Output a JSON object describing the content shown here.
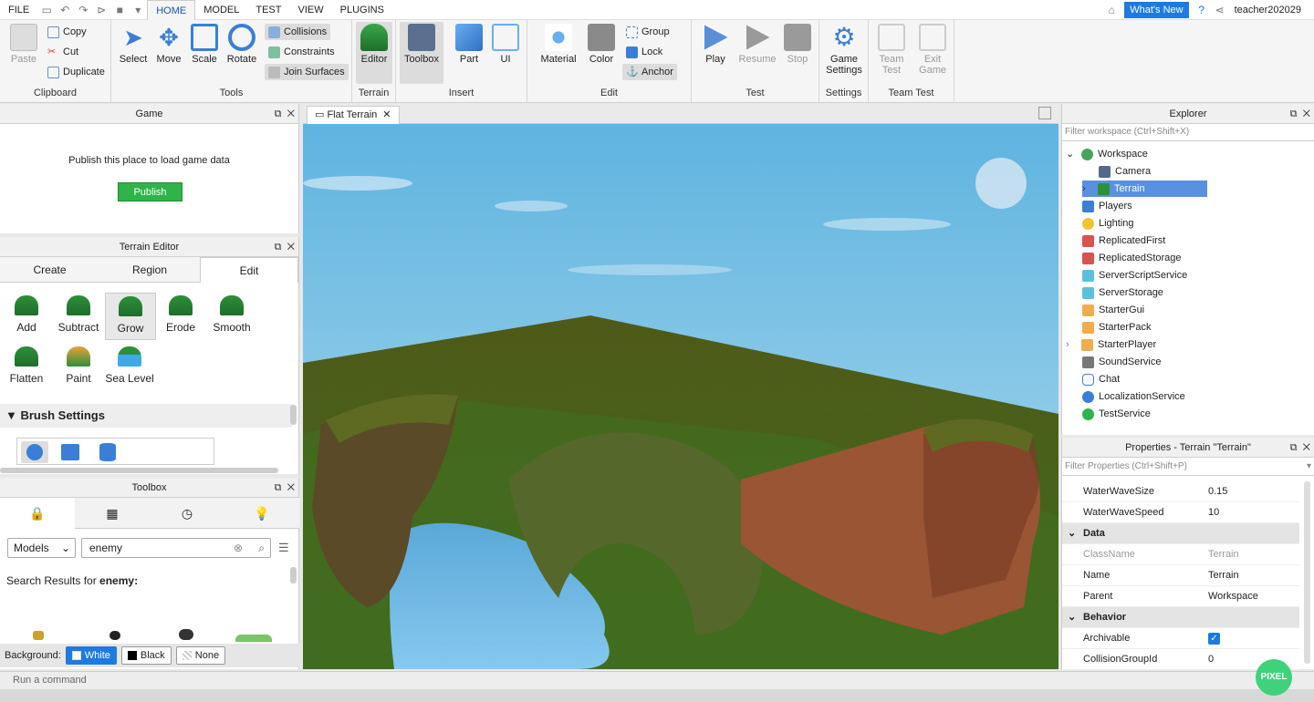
{
  "menu": {
    "file": "FILE",
    "tabs": [
      "HOME",
      "MODEL",
      "TEST",
      "VIEW",
      "PLUGINS"
    ],
    "whats_new": "What's New",
    "user": "teacher202029"
  },
  "ribbon": {
    "clipboard": {
      "paste": "Paste",
      "copy": "Copy",
      "cut": "Cut",
      "duplicate": "Duplicate",
      "label": "Clipboard"
    },
    "tools": {
      "select": "Select",
      "move": "Move",
      "scale": "Scale",
      "rotate": "Rotate",
      "collisions": "Collisions",
      "constraints": "Constraints",
      "join": "Join Surfaces",
      "label": "Tools"
    },
    "terrain": {
      "editor": "Editor",
      "label": "Terrain"
    },
    "insert": {
      "toolbox": "Toolbox",
      "part": "Part",
      "ui": "UI",
      "label": "Insert"
    },
    "edit": {
      "material": "Material",
      "color": "Color",
      "group": "Group",
      "lock": "Lock",
      "anchor": "Anchor",
      "label": "Edit"
    },
    "test": {
      "play": "Play",
      "resume": "Resume",
      "stop": "Stop",
      "label": "Test"
    },
    "settings": {
      "game_settings_1": "Game",
      "game_settings_2": "Settings",
      "label": "Settings"
    },
    "team_test": {
      "team_1": "Team",
      "team_2": "Test",
      "exit_1": "Exit",
      "exit_2": "Game",
      "label": "Team Test"
    }
  },
  "game_panel": {
    "title": "Game",
    "message": "Publish this place to load game data",
    "publish": "Publish"
  },
  "terrain_editor": {
    "title": "Terrain Editor",
    "tabs": [
      "Create",
      "Region",
      "Edit"
    ],
    "tools": [
      "Add",
      "Subtract",
      "Grow",
      "Erode",
      "Smooth",
      "Flatten",
      "Paint",
      "Sea Level"
    ],
    "brush_settings": "Brush Settings"
  },
  "toolbox": {
    "title": "Toolbox",
    "category": "Models",
    "search_value": "enemy",
    "results_prefix": "Search Results for ",
    "results_term": "enemy:",
    "background_label": "Background:",
    "bg_options": [
      "White",
      "Black",
      "None"
    ]
  },
  "viewport": {
    "tab": "Flat Terrain"
  },
  "explorer": {
    "title": "Explorer",
    "filter_placeholder": "Filter workspace (Ctrl+Shift+X)",
    "items": [
      "Workspace",
      "Camera",
      "Terrain",
      "Players",
      "Lighting",
      "ReplicatedFirst",
      "ReplicatedStorage",
      "ServerScriptService",
      "ServerStorage",
      "StarterGui",
      "StarterPack",
      "StarterPlayer",
      "SoundService",
      "Chat",
      "LocalizationService",
      "TestService"
    ]
  },
  "properties": {
    "title": "Properties - Terrain \"Terrain\"",
    "filter_placeholder": "Filter Properties (Ctrl+Shift+P)",
    "rows": [
      {
        "name": "WaterWaveSize",
        "value": "0.15"
      },
      {
        "name": "WaterWaveSpeed",
        "value": "10"
      },
      {
        "name": "Data",
        "value": ""
      },
      {
        "name": "ClassName",
        "value": "Terrain"
      },
      {
        "name": "Name",
        "value": "Terrain"
      },
      {
        "name": "Parent",
        "value": "Workspace"
      },
      {
        "name": "Behavior",
        "value": ""
      },
      {
        "name": "Archivable",
        "value": ""
      },
      {
        "name": "CollisionGroupId",
        "value": "0"
      }
    ]
  },
  "command_bar": {
    "placeholder": "Run a command"
  },
  "watermark": "PIXEL"
}
